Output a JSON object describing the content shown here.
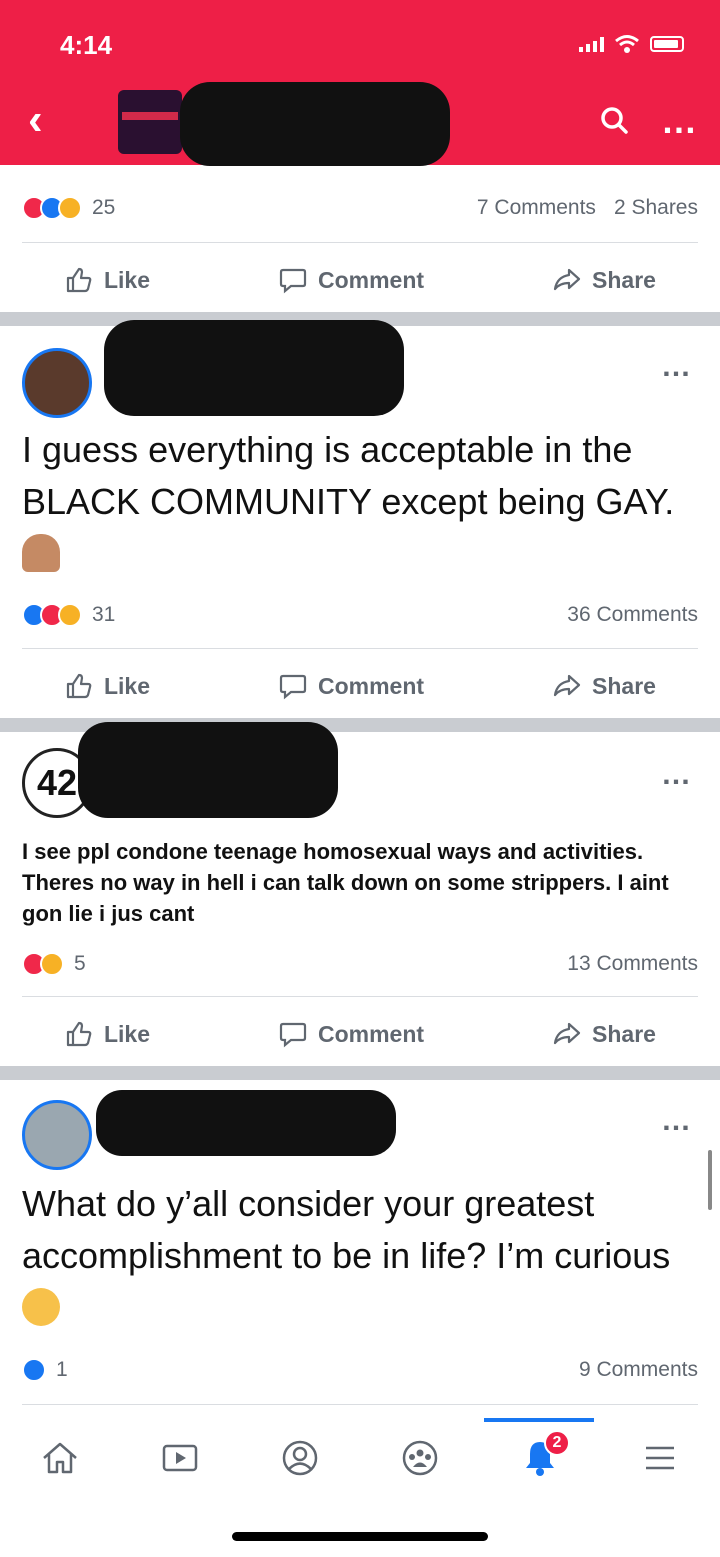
{
  "status_bar": {
    "time": "4:14"
  },
  "header": {
    "page_name_redacted": true
  },
  "posts": [
    {
      "reaction_count": "25",
      "comments": "7 Comments",
      "shares": "2 Shares",
      "actions": {
        "like": "Like",
        "comment": "Comment",
        "share": "Share"
      }
    },
    {
      "text": "I guess everything is acceptable in the BLACK COMMUNITY except being GAY.",
      "reaction_count": "31",
      "comments": "36 Comments",
      "actions": {
        "like": "Like",
        "comment": "Comment",
        "share": "Share"
      }
    },
    {
      "avatar_text": "42",
      "text": "I see ppl condone teenage homosexual ways and activities. Theres no way in hell i can talk down on some strippers. I aint gon lie i jus cant",
      "reaction_count": "5",
      "comments": "13 Comments",
      "actions": {
        "like": "Like",
        "comment": "Comment",
        "share": "Share"
      }
    },
    {
      "text": "What do y’all consider your greatest accomplishment to be in life? I’m curious",
      "reaction_count": "1",
      "comments": "9 Comments"
    }
  ],
  "bottom_nav": {
    "notification_badge": "2"
  },
  "colors": {
    "brand_red": "#ee1f47",
    "facebook_blue": "#1877f2"
  }
}
